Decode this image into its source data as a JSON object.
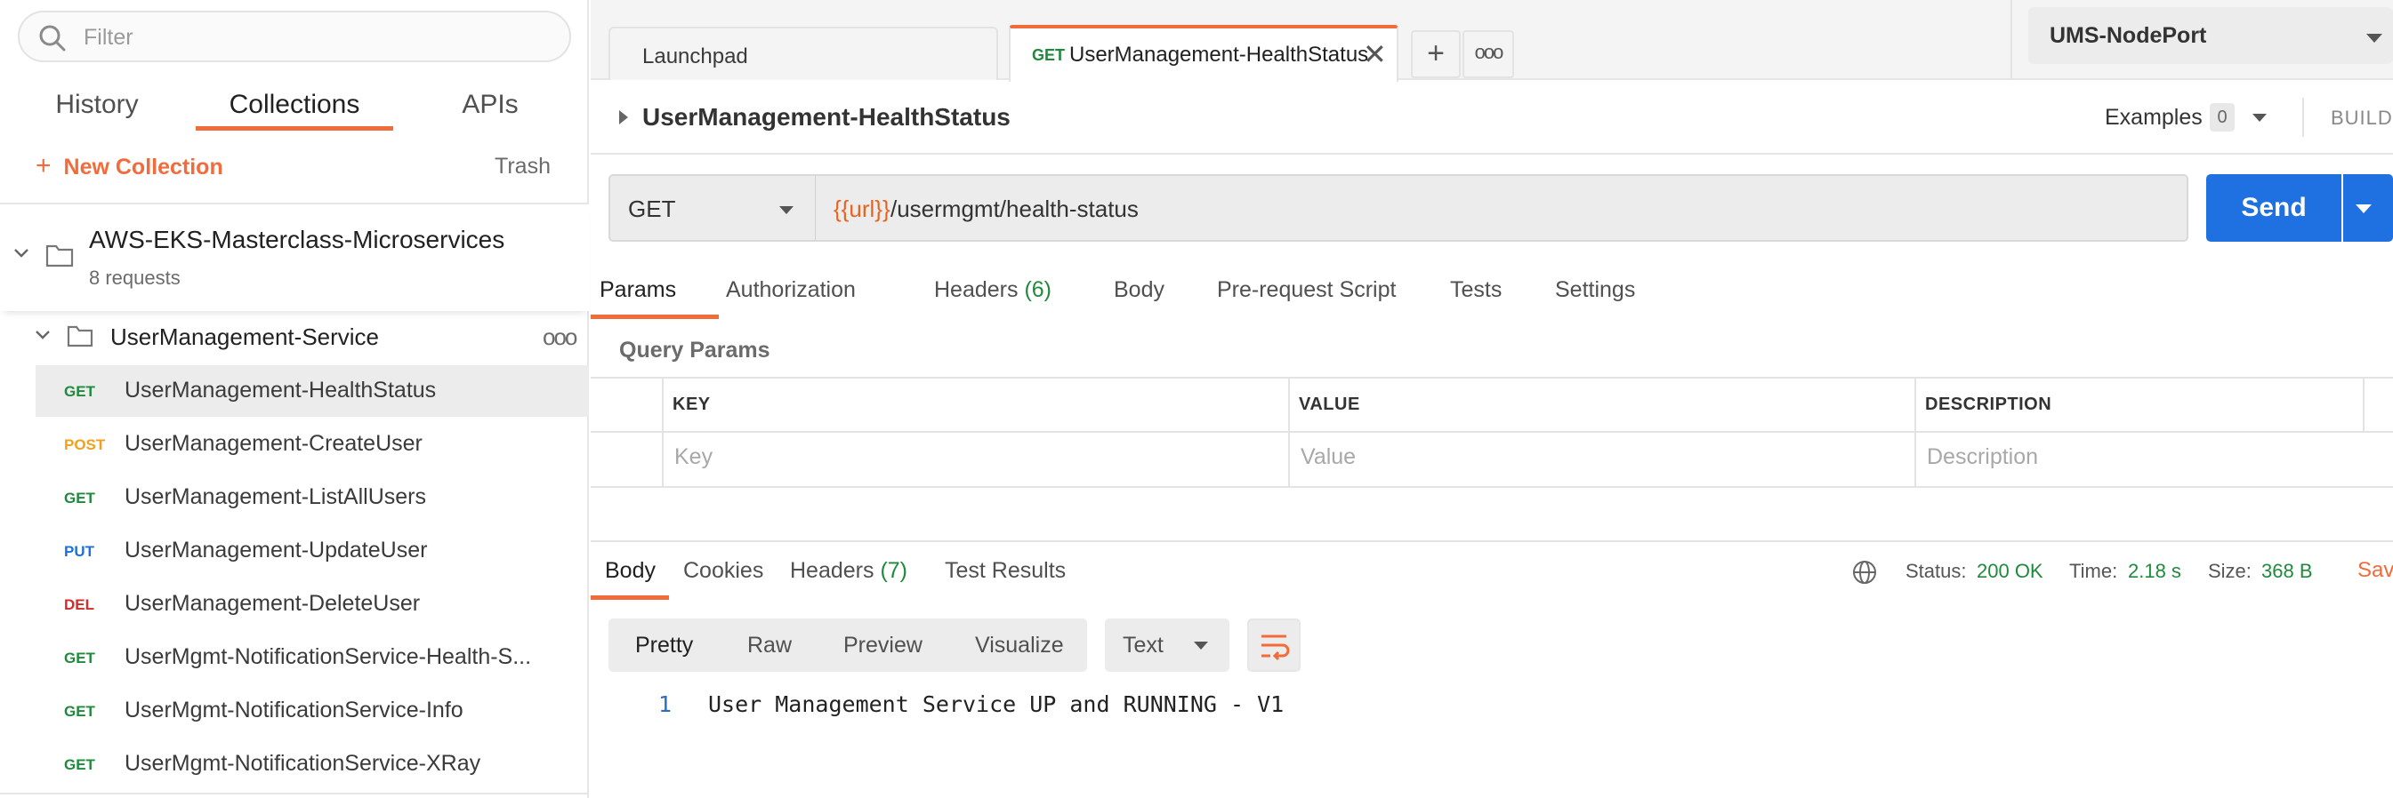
{
  "sidebar": {
    "filter_placeholder": "Filter",
    "tabs": [
      "History",
      "Collections",
      "APIs"
    ],
    "new_collection": "New Collection",
    "trash": "Trash",
    "collection": {
      "name": "AWS-EKS-Masterclass-Microservices",
      "count": "8 requests"
    },
    "folder": {
      "name": "UserManagement-Service",
      "more": "ooo"
    },
    "requests": [
      {
        "method": "GET",
        "name": "UserManagement-HealthStatus",
        "color": "#1f8a3c"
      },
      {
        "method": "POST",
        "name": "UserManagement-CreateUser",
        "color": "#f0a01e"
      },
      {
        "method": "GET",
        "name": "UserManagement-ListAllUsers",
        "color": "#1f8a3c"
      },
      {
        "method": "PUT",
        "name": "UserManagement-UpdateUser",
        "color": "#1f6fd6"
      },
      {
        "method": "DEL",
        "name": "UserManagement-DeleteUser",
        "color": "#d12b2b"
      },
      {
        "method": "GET",
        "name": "UserMgmt-NotificationService-Health-S...",
        "color": "#1f8a3c"
      },
      {
        "method": "GET",
        "name": "UserMgmt-NotificationService-Info",
        "color": "#1f8a3c"
      },
      {
        "method": "GET",
        "name": "UserMgmt-NotificationService-XRay",
        "color": "#1f8a3c"
      }
    ]
  },
  "tabs": {
    "launchpad": "Launchpad",
    "active": {
      "method": "GET",
      "title": "UserManagement-HealthStatus"
    }
  },
  "environment": "UMS-NodePort",
  "request": {
    "title": "UserManagement-HealthStatus",
    "examples_label": "Examples",
    "examples_count": "0",
    "build_label": "BUILD",
    "method": "GET",
    "url_var": "{{url}}",
    "url_path": "/usermgmt/health-status",
    "send": "Send",
    "tabs": [
      "Params",
      "Authorization",
      "Headers",
      "Body",
      "Pre-request Script",
      "Tests",
      "Settings"
    ],
    "headers_count": "(6)",
    "query_params_label": "Query Params",
    "table": {
      "columns": [
        "KEY",
        "VALUE",
        "DESCRIPTION"
      ],
      "placeholders": [
        "Key",
        "Value",
        "Description"
      ]
    }
  },
  "response": {
    "tabs": [
      "Body",
      "Cookies",
      "Headers",
      "Test Results"
    ],
    "headers_count": "(7)",
    "status_label": "Status:",
    "status_value": "200 OK",
    "time_label": "Time:",
    "time_value": "2.18 s",
    "size_label": "Size:",
    "size_value": "368 B",
    "save_label": "Sav",
    "views": [
      "Pretty",
      "Raw",
      "Preview",
      "Visualize"
    ],
    "format": "Text",
    "line_number": "1",
    "body_text": "User Management Service UP and RUNNING - V1"
  },
  "colors": {
    "accent": "#f26b3a",
    "send": "#1f70e0",
    "success": "#1f8a3c"
  }
}
